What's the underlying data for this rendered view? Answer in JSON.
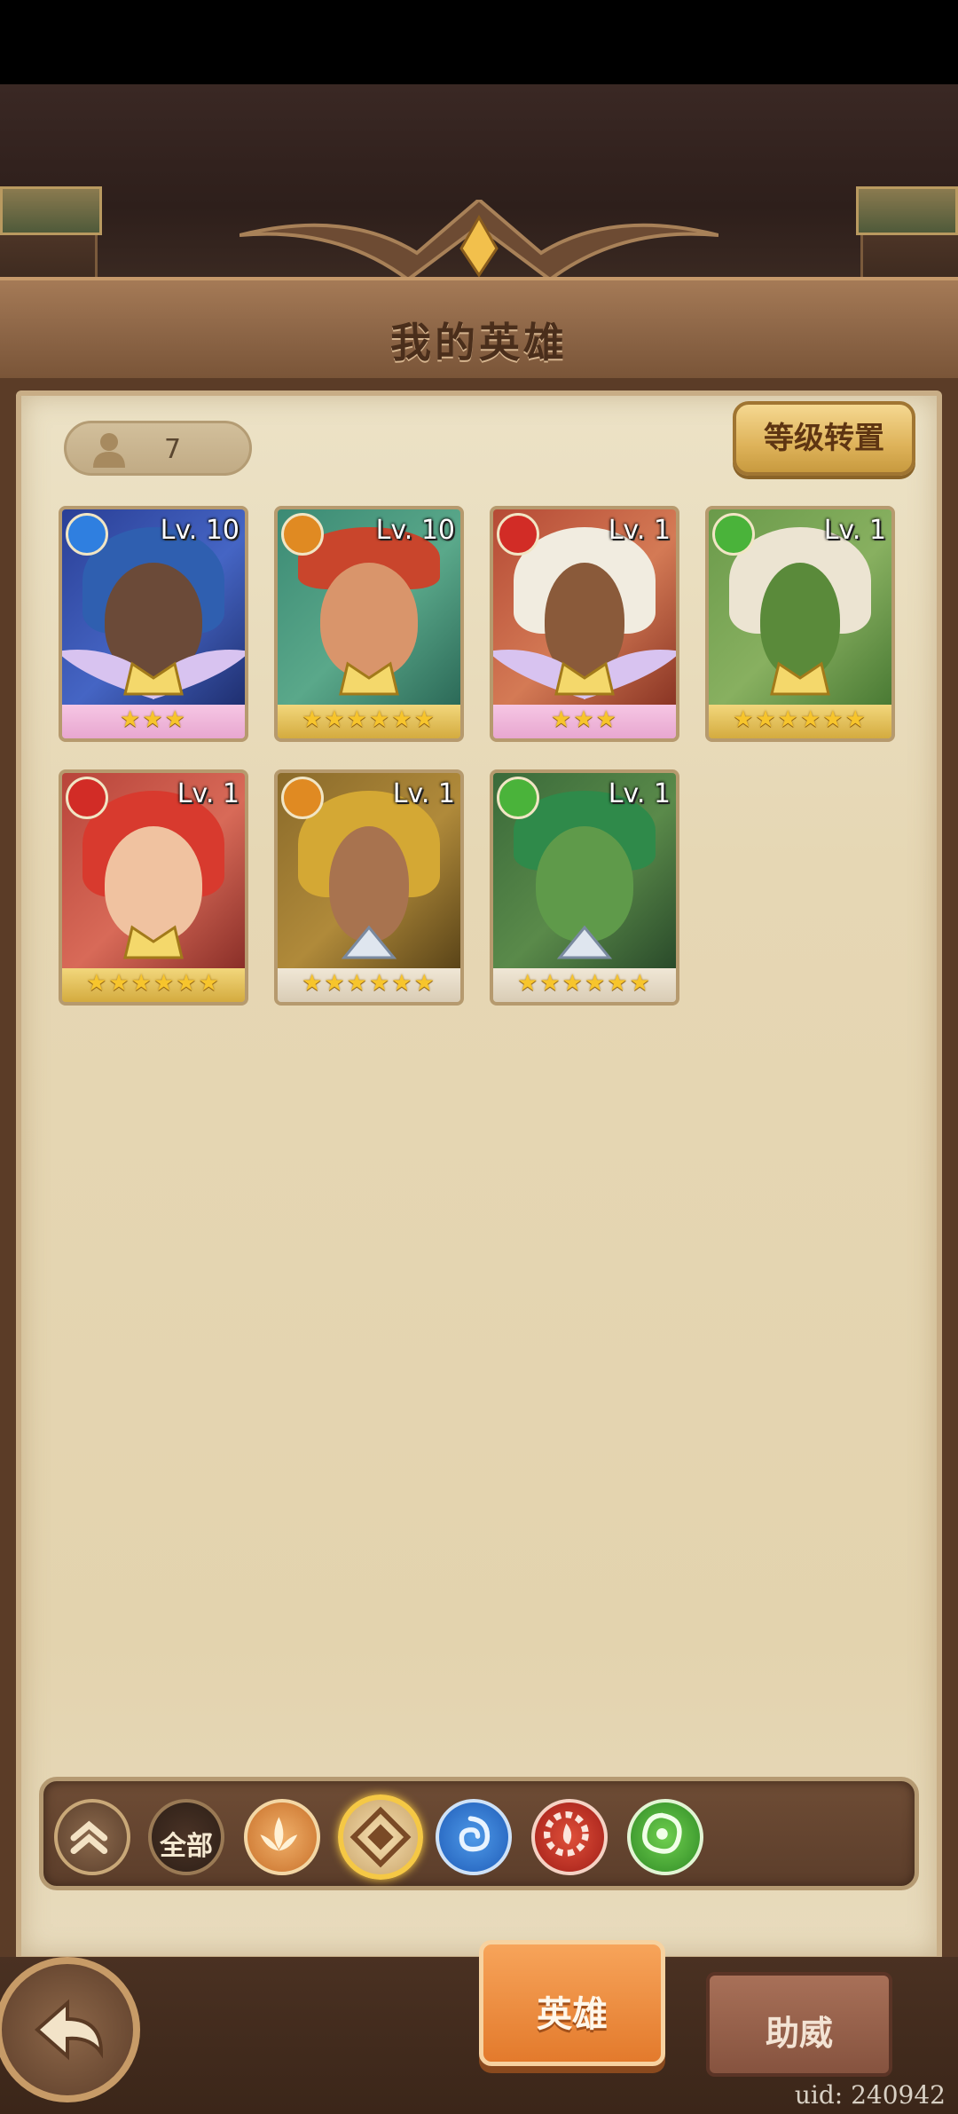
{
  "header": {
    "title": "我的英雄"
  },
  "roster": {
    "count": "7",
    "level_reset_label": "等级转置"
  },
  "heroes": [
    {
      "level": "Lv. 10",
      "element": "water",
      "stars": "★★★",
      "star_count": 3,
      "frame": "pink"
    },
    {
      "level": "Lv. 10",
      "element": "earth",
      "stars": "★★★★★★",
      "star_count": 6,
      "frame": "gold"
    },
    {
      "level": "Lv. 1",
      "element": "fire",
      "stars": "★★★",
      "star_count": 3,
      "frame": "pink"
    },
    {
      "level": "Lv. 1",
      "element": "wind",
      "stars": "★★★★★★",
      "star_count": 6,
      "frame": "gold"
    },
    {
      "level": "Lv. 1",
      "element": "fire",
      "stars": "★★★★★★",
      "star_count": 6,
      "frame": "gold"
    },
    {
      "level": "Lv. 1",
      "element": "earth",
      "stars": "★★★★★★",
      "star_count": 6,
      "frame": "silver"
    },
    {
      "level": "Lv. 1",
      "element": "wind",
      "stars": "★★★★★★",
      "star_count": 6,
      "frame": "silver"
    }
  ],
  "filters": {
    "all_label": "全部",
    "items": [
      "collapse",
      "all",
      "light",
      "earth",
      "water",
      "fire",
      "wind"
    ],
    "selected": "earth"
  },
  "bottom_tabs": {
    "hero": "英雄",
    "support": "助威"
  },
  "footer": {
    "uid": "uid: 240942"
  },
  "colors": {
    "water": "#2f7fe0",
    "earth": "#e08a22",
    "fire": "#d22c26",
    "wind": "#4ab33a",
    "accent": "#e37a2c"
  }
}
